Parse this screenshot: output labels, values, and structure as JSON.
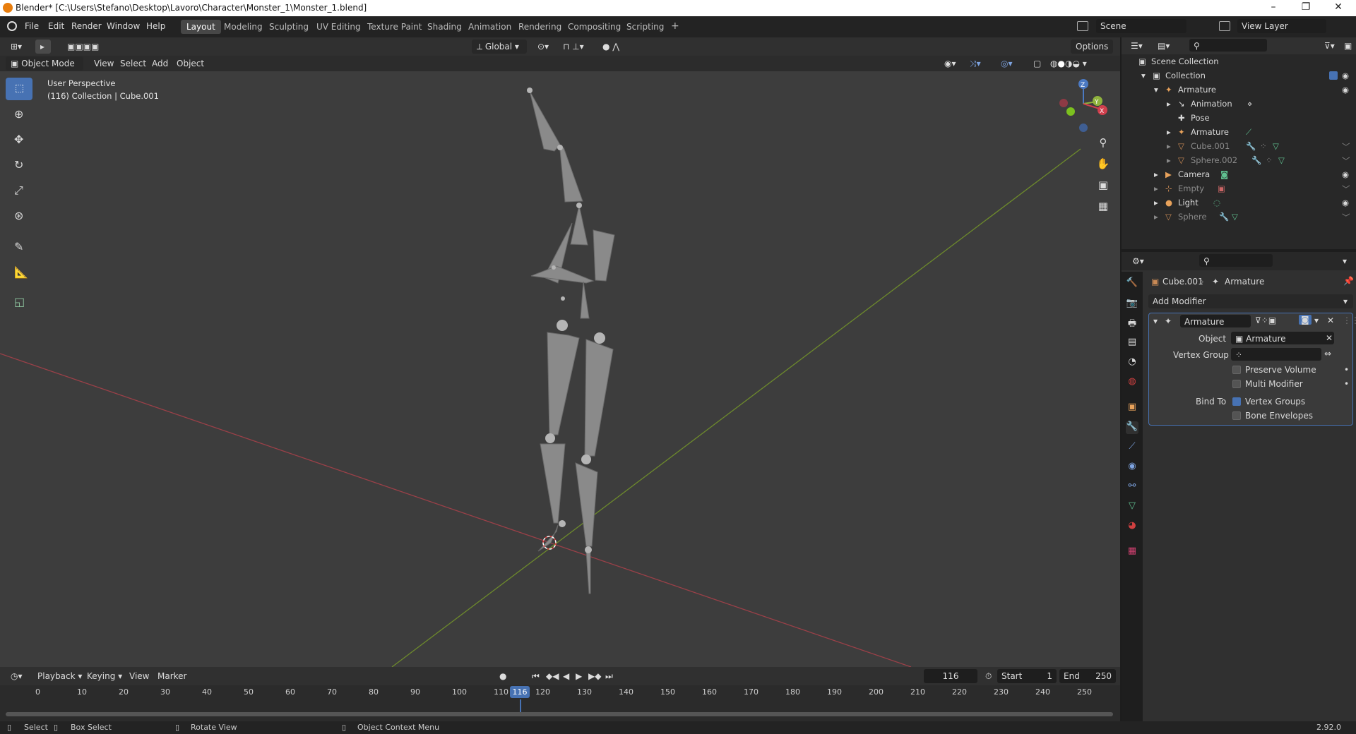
{
  "window": {
    "title": "Blender* [C:\\Users\\Stefano\\Desktop\\Lavoro\\Character\\Monster_1\\Monster_1.blend]",
    "minimize": "–",
    "maximize": "❐",
    "close": "✕"
  },
  "menu": [
    "File",
    "Edit",
    "Render",
    "Window",
    "Help"
  ],
  "workspaces": [
    "Layout",
    "Modeling",
    "Sculpting",
    "UV Editing",
    "Texture Paint",
    "Shading",
    "Animation",
    "Rendering",
    "Compositing",
    "Scripting"
  ],
  "add_workspace": "+",
  "scene": {
    "name": "Scene",
    "view_layer": "View Layer"
  },
  "viewport_header": {
    "mode": "Object Mode",
    "menus": [
      "View",
      "Select",
      "Add",
      "Object"
    ],
    "orientation": "Global",
    "options": "Options"
  },
  "viewport": {
    "perspective": "User Perspective",
    "collection_info": "(116) Collection | Cube.001",
    "gizmo": {
      "z": "Z",
      "y": "Y",
      "x": "X"
    }
  },
  "outliner": {
    "scene_collection": "Scene Collection",
    "items": [
      {
        "label": "Collection",
        "depth": 1
      },
      {
        "label": "Armature",
        "depth": 2
      },
      {
        "label": "Animation",
        "depth": 3
      },
      {
        "label": "Pose",
        "depth": 3
      },
      {
        "label": "Armature",
        "depth": 3
      },
      {
        "label": "Cube.001",
        "depth": 3
      },
      {
        "label": "Sphere.002",
        "depth": 3
      },
      {
        "label": "Camera",
        "depth": 2
      },
      {
        "label": "Empty",
        "depth": 2
      },
      {
        "label": "Light",
        "depth": 2
      },
      {
        "label": "Sphere",
        "depth": 2
      }
    ]
  },
  "properties": {
    "breadcrumb_object": "Cube.001",
    "breadcrumb_modifier": "Armature",
    "add_modifier": "Add Modifier",
    "modifier_name": "Armature",
    "object_label": "Object",
    "object_value": "Armature",
    "vertex_group_label": "Vertex Group",
    "preserve_volume": "Preserve Volume",
    "multi_modifier": "Multi Modifier",
    "bind_to_label": "Bind To",
    "vertex_groups": "Vertex Groups",
    "bone_envelopes": "Bone Envelopes"
  },
  "timeline": {
    "menus": [
      "Playback",
      "Keying",
      "View",
      "Marker"
    ],
    "current_frame": "116",
    "start_label": "Start",
    "start_value": "1",
    "end_label": "End",
    "end_value": "250",
    "ticks": [
      "0",
      "10",
      "20",
      "30",
      "40",
      "50",
      "60",
      "70",
      "80",
      "90",
      "100",
      "110",
      "120",
      "130",
      "140",
      "150",
      "160",
      "170",
      "180",
      "190",
      "200",
      "210",
      "220",
      "230",
      "240",
      "250"
    ],
    "playhead": "116"
  },
  "status": {
    "select": "Select",
    "box_select": "Box Select",
    "rotate_view": "Rotate View",
    "context_menu": "Object Context Menu",
    "version": "2.92.0"
  }
}
